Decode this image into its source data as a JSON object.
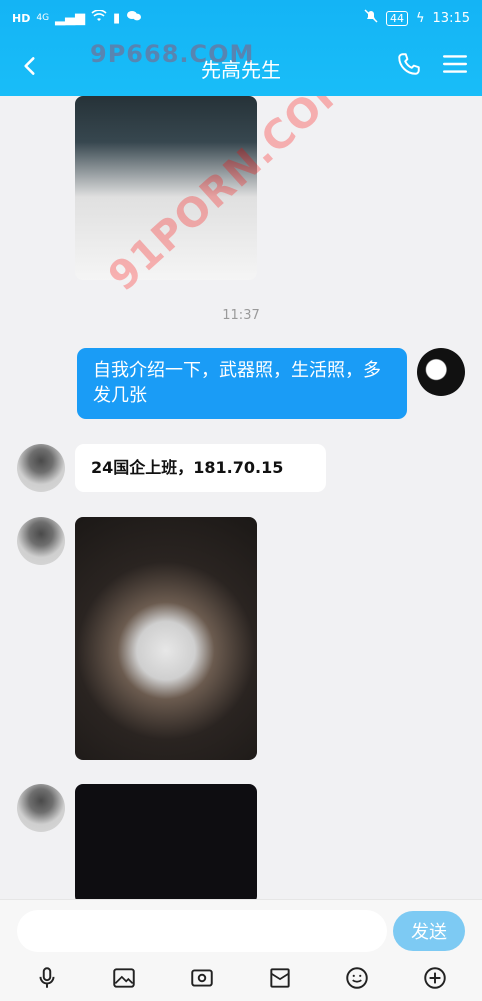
{
  "status": {
    "left_icons": [
      "hd-icon",
      "4g-icon",
      "signal-icon",
      "wifi-icon",
      "sim-icon",
      "wechat-icon"
    ],
    "mute": "mute-icon",
    "battery": "44",
    "charging_icon": "bolt-icon",
    "time": "13:15"
  },
  "header": {
    "back_icon": "chevron-left-icon",
    "title": "先高先生",
    "call_icon": "phone-icon",
    "menu_icon": "hamburger-icon"
  },
  "watermarks": {
    "top": "9P668.COM",
    "diagonal": "91PORN.COM"
  },
  "chat": {
    "timestamp": "11:37",
    "outgoing_message": "自我介绍一下，武器照，生活照，多发几张",
    "incoming_message": "24国企上班，181.70.15"
  },
  "composer": {
    "send_label": "发送"
  },
  "toolbar": {
    "items": [
      "microphone-icon",
      "image-icon",
      "camera-icon",
      "gift-icon",
      "emoji-icon",
      "plus-icon"
    ]
  },
  "colors": {
    "header": "#19bdf8",
    "outgoing_bubble": "#1a9cf6",
    "send_button": "#7dcaf3",
    "background": "#f1f1f3"
  }
}
